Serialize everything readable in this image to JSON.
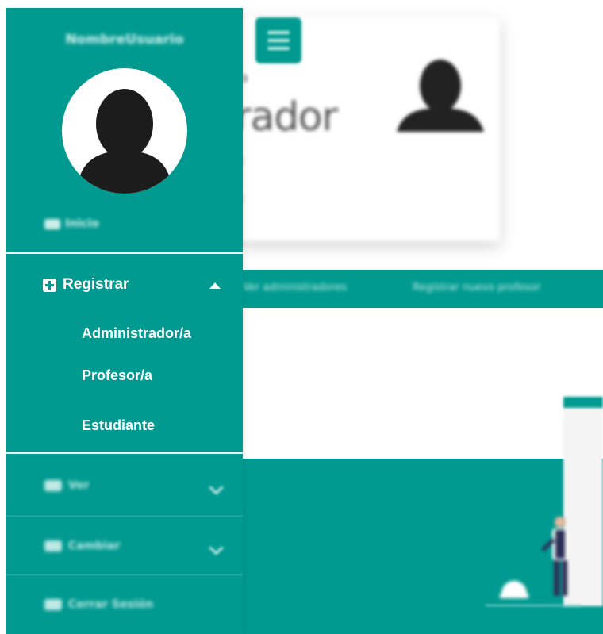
{
  "header": {
    "menu_icon": "hamburger-icon",
    "card_title": "rador"
  },
  "strip": {
    "items": [
      "Ver administradores",
      "Registrar nuevo profesor"
    ]
  },
  "sidebar": {
    "username": "NombreUsuario",
    "avatar_icon": "user-avatar-icon",
    "inicio": {
      "label": "Inicio",
      "icon": "home-icon"
    },
    "registrar": {
      "label": "Registrar",
      "icon": "plus-square-icon",
      "expanded": true,
      "items": [
        "Administrador/a",
        "Profesor/a",
        "Estudiante"
      ]
    },
    "ver": {
      "label": "Ver",
      "icon": "eye-icon"
    },
    "cambiar": {
      "label": "Cambiar",
      "icon": "edit-icon"
    },
    "logout": {
      "label": "Cerrar Sesión",
      "icon": "logout-icon"
    }
  },
  "colors": {
    "primary": "#009a90",
    "primary_light": "#bfe9e5",
    "white": "#ffffff"
  }
}
